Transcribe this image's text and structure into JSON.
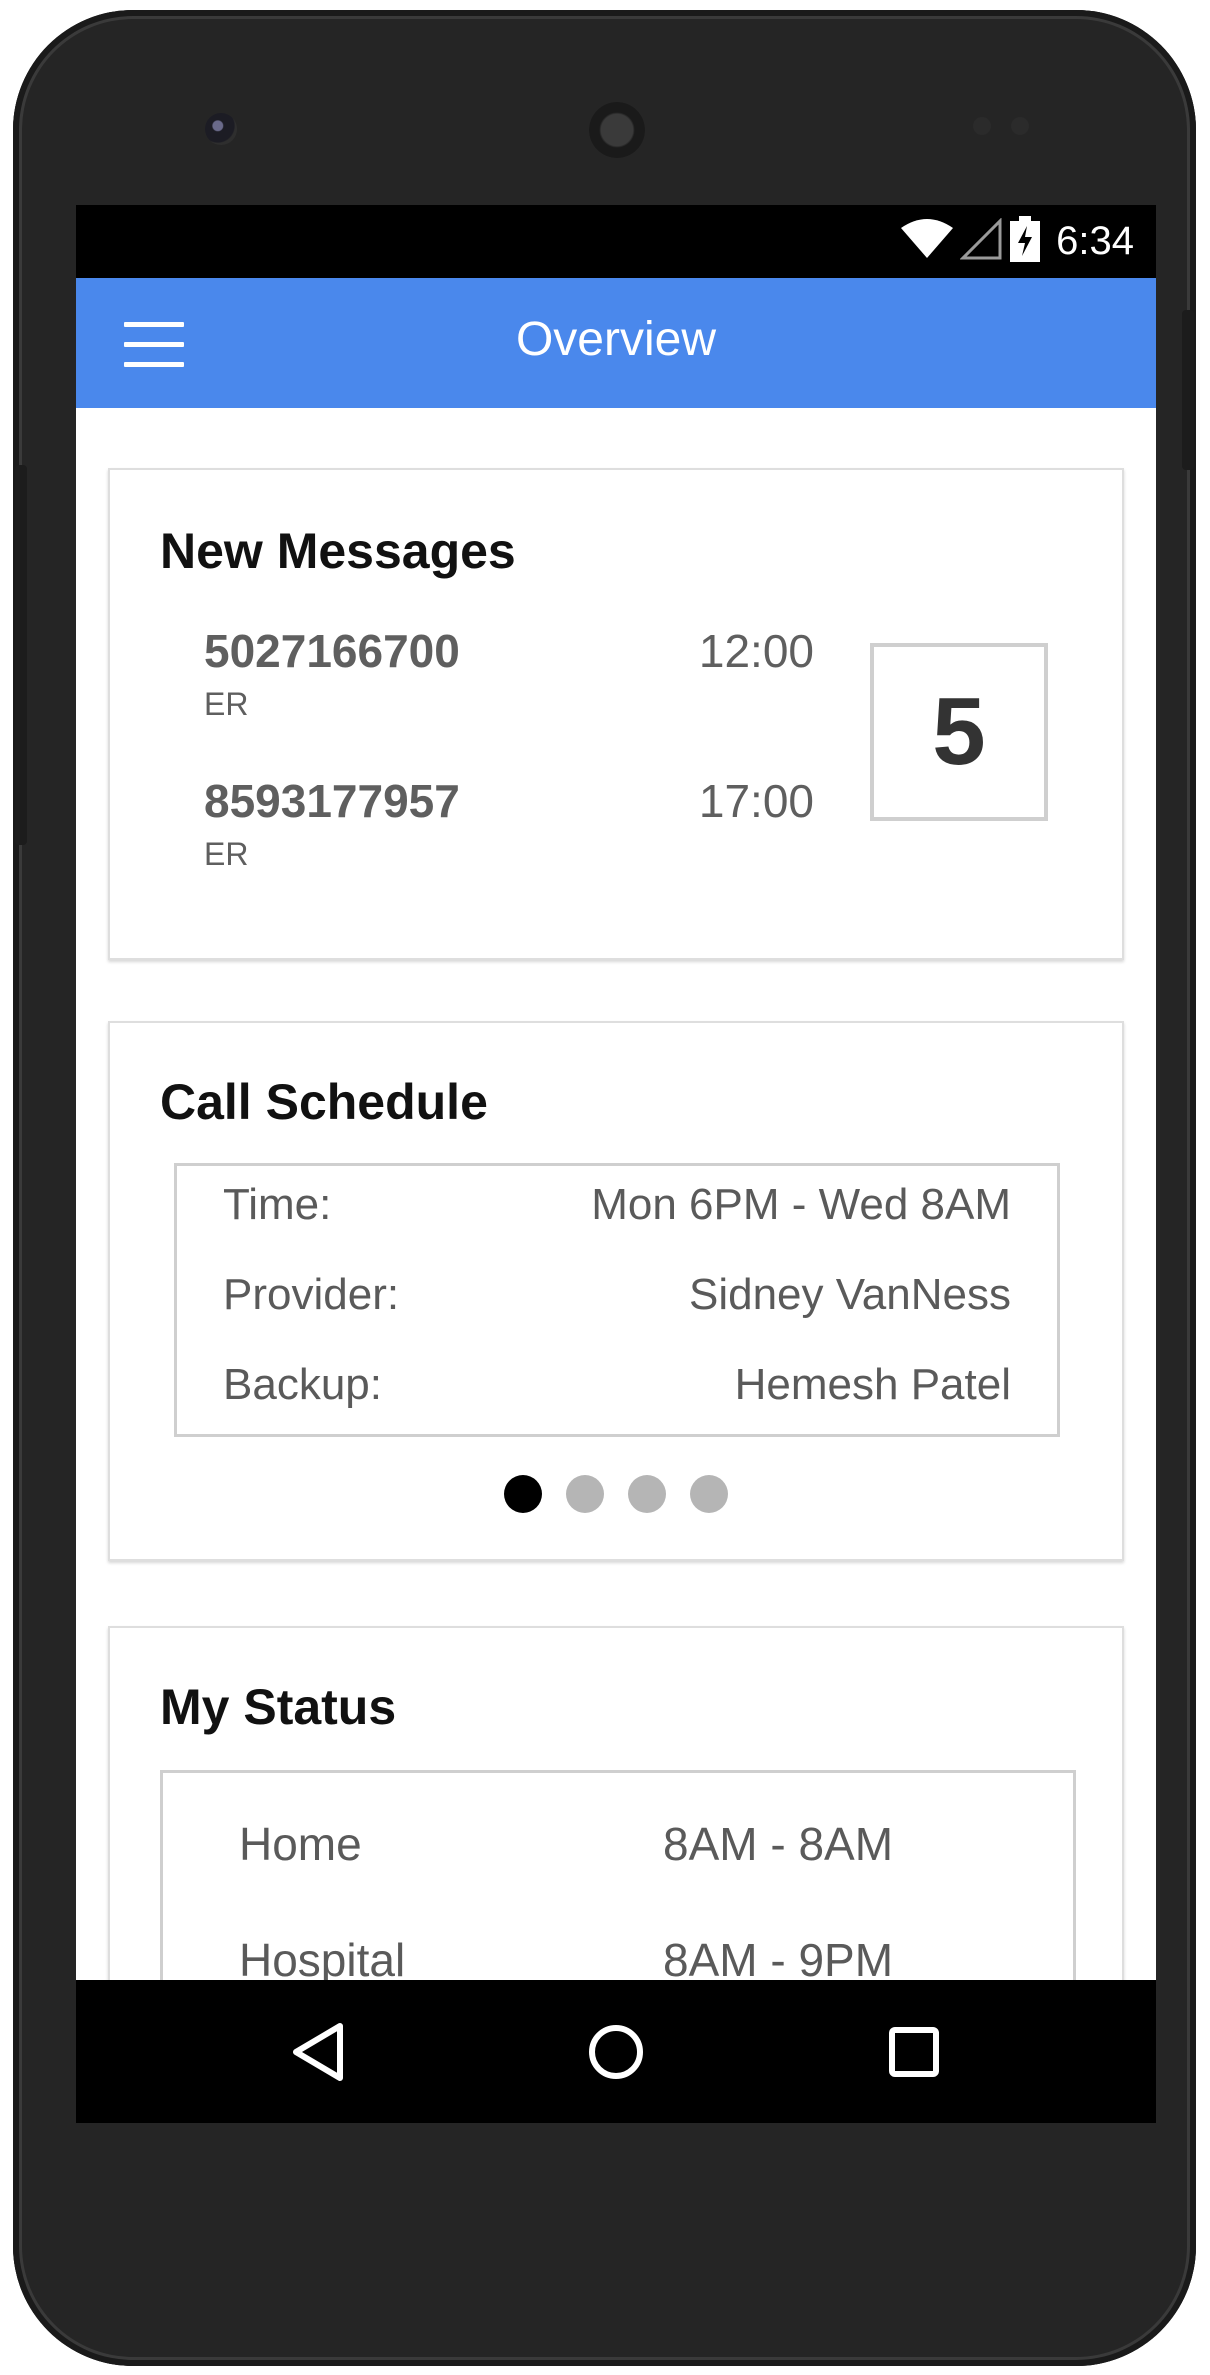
{
  "status_bar": {
    "time": "6:34"
  },
  "app_bar": {
    "title": "Overview"
  },
  "new_messages": {
    "title": "New Messages",
    "count": "5",
    "items": [
      {
        "number": "5027166700",
        "time": "12:00",
        "department": "ER"
      },
      {
        "number": "8593177957",
        "time": "17:00",
        "department": "ER"
      }
    ]
  },
  "call_schedule": {
    "title": "Call Schedule",
    "rows": [
      {
        "label": "Time:",
        "value": "Mon 6PM - Wed 8AM"
      },
      {
        "label": "Provider:",
        "value": "Sidney VanNess"
      },
      {
        "label": "Backup:",
        "value": "Hemesh Patel"
      }
    ],
    "page_count": 4,
    "active_page": 1
  },
  "my_status": {
    "title": "My Status",
    "rows": [
      {
        "place": "Home",
        "hours": "8AM - 8AM"
      },
      {
        "place": "Hospital",
        "hours": "8AM - 9PM"
      }
    ]
  },
  "colors": {
    "app_bar": "#4a88ec",
    "active_dot": "#000000",
    "inactive_dot": "#b5b5b5"
  },
  "icons": [
    "wifi-icon",
    "cell-signal-icon",
    "battery-charging-icon",
    "menu-icon",
    "back-icon",
    "home-icon",
    "recents-icon"
  ]
}
